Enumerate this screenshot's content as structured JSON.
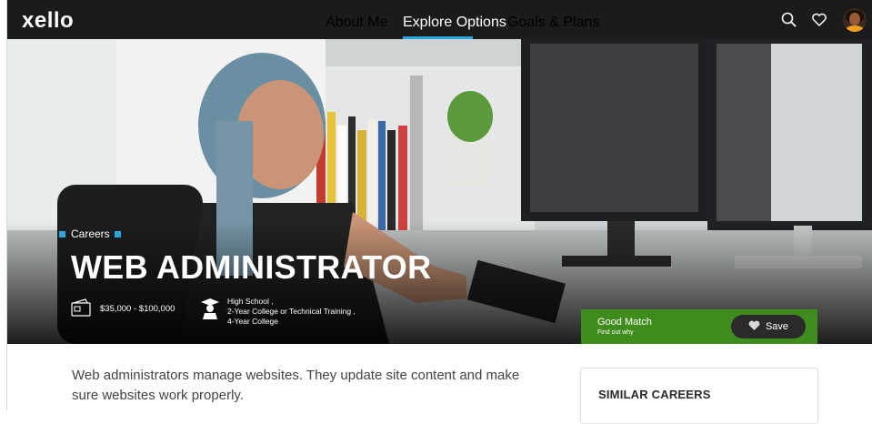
{
  "app": {
    "logo": "xello"
  },
  "nav": {
    "items": [
      {
        "label": "About Me",
        "active": false
      },
      {
        "label": "Explore Options",
        "active": true
      },
      {
        "label": "Goals & Plans",
        "active": false
      }
    ],
    "accent_color": "#29a7dd"
  },
  "icons": {
    "search": "search-icon",
    "favorites": "heart-icon",
    "profile": "avatar"
  },
  "hero": {
    "category": "Careers",
    "title": "WEB ADMINISTRATOR",
    "salary": "$35,000 - $100,000",
    "education": [
      "High School ,",
      "2-Year College or Technical Training ,",
      "4-Year College"
    ]
  },
  "match": {
    "title": "Good Match",
    "subtitle": "Find out why",
    "save_label": "Save",
    "color": "#3f8b1c"
  },
  "description": "Web administrators manage websites. They update site content and make sure websites work properly.",
  "similar": {
    "title": "SIMILAR CAREERS"
  }
}
